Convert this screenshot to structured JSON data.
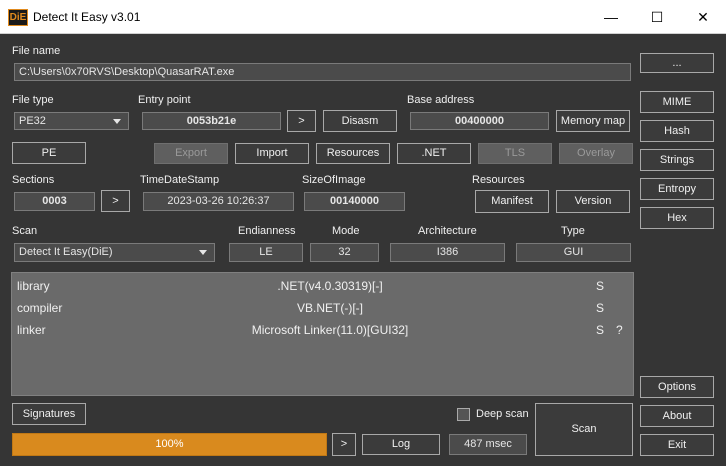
{
  "window": {
    "title": "Detect It Easy v3.01",
    "icon_text": "DiE",
    "minimize": "—",
    "maximize": "☐",
    "close": "✕"
  },
  "file_name": {
    "label": "File name",
    "value": "C:\\Users\\0x70RVS\\Desktop\\QuasarRAT.exe",
    "browse_button": "..."
  },
  "file_type": {
    "label": "File type",
    "value": "PE32"
  },
  "entry_point": {
    "label": "Entry point",
    "value": "0053b21e",
    "go_button": ">",
    "disasm_button": "Disasm"
  },
  "base_address": {
    "label": "Base address",
    "value": "00400000",
    "memory_map_button": "Memory map"
  },
  "pe_buttons": {
    "pe": "PE",
    "export": "Export",
    "import": "Import",
    "resources": "Resources",
    "net": ".NET",
    "tls": "TLS",
    "overlay": "Overlay"
  },
  "sections": {
    "label": "Sections",
    "value": "0003",
    "go_button": ">"
  },
  "timedatestamp": {
    "label": "TimeDateStamp",
    "value": "2023-03-26 10:26:37"
  },
  "size_of_image": {
    "label": "SizeOfImage",
    "value": "00140000"
  },
  "resources": {
    "label": "Resources",
    "manifest_button": "Manifest",
    "version_button": "Version"
  },
  "scan": {
    "label": "Scan",
    "engine": "Detect It Easy(DiE)"
  },
  "endianness": {
    "label": "Endianness",
    "value": "LE"
  },
  "mode": {
    "label": "Mode",
    "value": "32"
  },
  "architecture": {
    "label": "Architecture",
    "value": "I386"
  },
  "type": {
    "label": "Type",
    "value": "GUI"
  },
  "results": [
    {
      "type": "library",
      "name": ".NET(v4.0.30319)[-]",
      "s": "S",
      "q": ""
    },
    {
      "type": "compiler",
      "name": "VB.NET(-)[-]",
      "s": "S",
      "q": ""
    },
    {
      "type": "linker",
      "name": "Microsoft Linker(11.0)[GUI32]",
      "s": "S",
      "q": "?"
    }
  ],
  "bottom": {
    "signatures_button": "Signatures",
    "deep_scan_label": "Deep scan",
    "deep_scan_checked": false,
    "progress_text": "100%",
    "progress_value": 100,
    "progress_color": "#d98a1e",
    "go_button": ">",
    "log_button": "Log",
    "time": "487 msec",
    "scan_button": "Scan"
  },
  "sidebar": {
    "mime": "MIME",
    "hash": "Hash",
    "strings": "Strings",
    "entropy": "Entropy",
    "hex": "Hex",
    "options": "Options",
    "about": "About",
    "exit": "Exit"
  }
}
